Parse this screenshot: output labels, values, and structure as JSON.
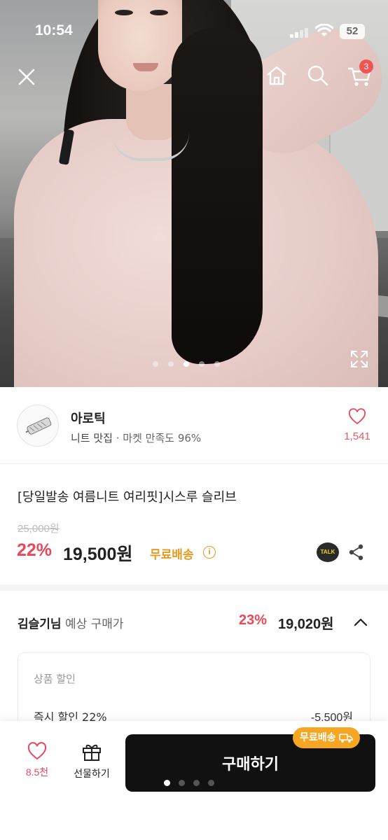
{
  "status_bar": {
    "time": "10:54",
    "battery": "52"
  },
  "top_nav": {
    "cart_count": "3"
  },
  "gallery": {
    "page_count": 5,
    "active_index": 3
  },
  "seller": {
    "name": "아로틱",
    "tagline": "니트 맛집",
    "satisfaction": "· 마켓 만족도 96%",
    "like_count": "1,541"
  },
  "product": {
    "title": "[당일발송 여름니트 여리핏]시스루 슬리브",
    "original_price": "25,000원",
    "discount_percent": "22%",
    "price": "19,500원",
    "shipping": "무료배송",
    "talk_label": "TALK"
  },
  "member_price": {
    "name": "김슬기님",
    "label": " 예상 구매가",
    "discount_percent": "23%",
    "price": "19,020원"
  },
  "discount_detail": {
    "heading": "상품 할인",
    "rows": [
      {
        "label": "즉시 할인 22%",
        "amount": "-5,500원"
      }
    ]
  },
  "bottom_bar": {
    "wish_count": "8.5천",
    "gift_label": "선물하기",
    "buy_label": "구매하기",
    "shipping_pill": "무료배송",
    "page_count": 4,
    "active_index": 0
  },
  "colors": {
    "accent_red": "#e8485b",
    "shipping_orange": "#e99a1d",
    "buy_button": "#111111"
  }
}
